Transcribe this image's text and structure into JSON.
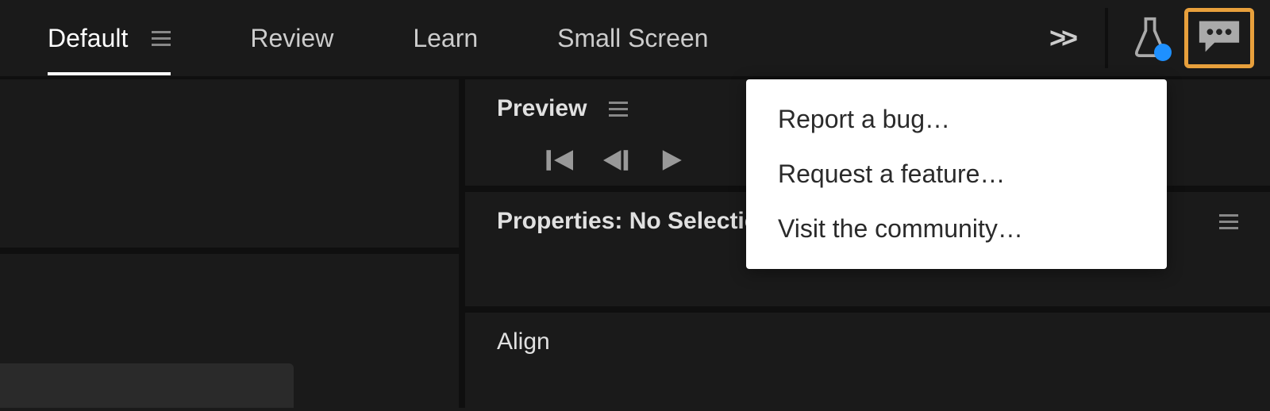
{
  "workspace_tabs": {
    "default": "Default",
    "review": "Review",
    "learn": "Learn",
    "small_screen": "Small Screen"
  },
  "panels": {
    "preview": "Preview",
    "properties": "Properties: No Selection",
    "align": "Align"
  },
  "popup": {
    "report_bug": "Report a bug…",
    "request_feature": "Request a feature…",
    "visit_community": "Visit the community…"
  }
}
